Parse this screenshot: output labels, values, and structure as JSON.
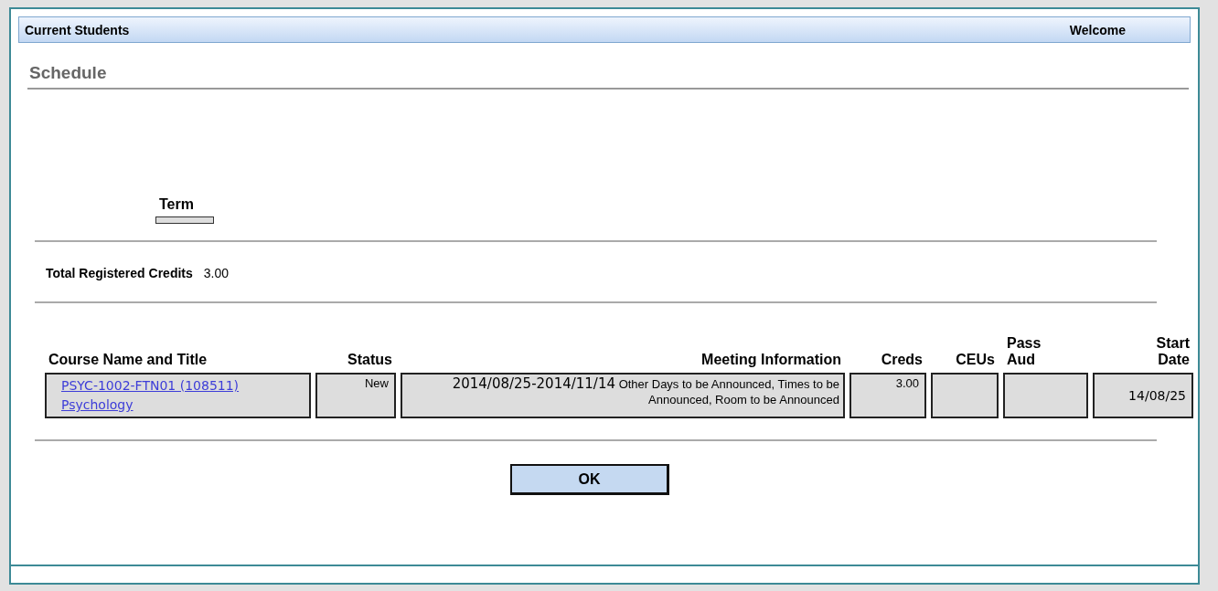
{
  "header": {
    "title": "Current Students",
    "welcome": "Welcome"
  },
  "page_title": "Schedule",
  "term": {
    "label": "Term"
  },
  "total_credits": {
    "label": "Total Registered Credits",
    "value": "3.00"
  },
  "table": {
    "columns": [
      "Course Name and Title",
      "Status",
      "Meeting Information",
      "Creds",
      "CEUs",
      "Pass Aud",
      "Start Date"
    ],
    "rows": [
      {
        "course_code": "PSYC-1002-FTN01 (108511)",
        "course_title": "Psychology",
        "status": "New",
        "meeting_dates": "2014/08/25-2014/11/14",
        "meeting_details": "Other Days to be Announced, Times to be Announced, Room to be Announced",
        "creds": "3.00",
        "start_date": "14/08/25"
      }
    ]
  },
  "ok_button": "OK"
}
